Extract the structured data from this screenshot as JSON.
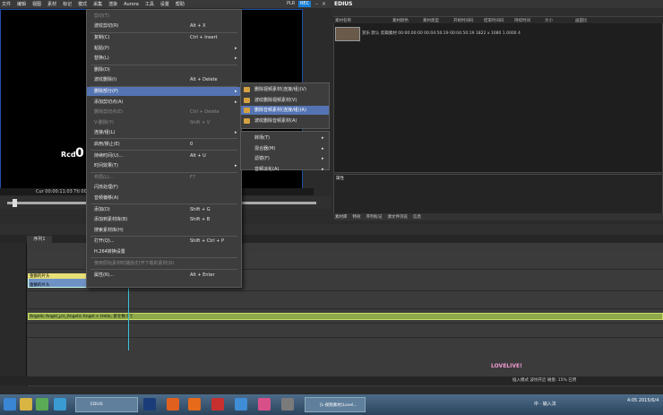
{
  "menubar": {
    "items": [
      "文件",
      "编辑",
      "视图",
      "素材",
      "标记",
      "模式",
      "采集",
      "渲染",
      "Aurora",
      "工具",
      "设置",
      "帮助"
    ]
  },
  "title": {
    "plr": "PLR",
    "rec": "REC",
    "app": "EDIUS"
  },
  "preview": {
    "rcd": "Rcd",
    "rcd_value": "0",
    "timecode": "Cur 00:00:11:03  Ttl 00:00:00:00"
  },
  "bin": {
    "header": [
      "素材名称",
      "素材颜色",
      "素材类型",
      "开始时间码",
      "结束时间码",
      "持续时间",
      "大小",
      "画面比"
    ],
    "clip_name": "赏乐",
    "clip_row": "赏乐   默认   剪辑素材   00:00:00:00  00:04:50:19  00:04:50:19  1822 x 1080  1.0000  4"
  },
  "bin_info": {
    "label": "属性"
  },
  "right_tabs": [
    "素材库",
    "特效",
    "序列标记",
    "源文件浏览",
    "信息"
  ],
  "timeline": {
    "tab": "序列1",
    "clip_v": "金额的片头",
    "clip_v2": "金额的片头",
    "audio": "Angelic Angel_µ's_Angelic Angel + Hello, 星を数えて",
    "status": "插入模式    波纹开启    磁盘: 15% 已用"
  },
  "logo": "LOVELIVE!",
  "taskbar": {
    "btn1": "EDIUS",
    "btn2": "[L-视频素材]Lovel...",
    "ime": "中 · 输入法",
    "clock": "4:05\n2015/6/4"
  },
  "context_menu": [
    {
      "label": "剪切(T)",
      "shortcut": "",
      "state": "disabled"
    },
    {
      "label": "波纹剪切(R)",
      "shortcut": "Alt + X",
      "state": "normal"
    },
    {
      "label": "复制(C)",
      "shortcut": "Ctrl + Insert",
      "state": "normal"
    },
    {
      "label": "粘贴(P)",
      "shortcut": "",
      "state": "submenu"
    },
    {
      "label": "替换(L)",
      "shortcut": "",
      "state": "submenu"
    },
    {
      "label": "删除(D)",
      "shortcut": "",
      "state": "normal"
    },
    {
      "label": "波纹删除(I)",
      "shortcut": "Alt + Delete",
      "state": "normal"
    },
    {
      "label": "删除部分(P)",
      "shortcut": "",
      "state": "highlighted"
    },
    {
      "label": "添加剪切点(A)",
      "shortcut": "",
      "state": "submenu"
    },
    {
      "label": "删除剪切点(E)",
      "shortcut": "Ctrl + Delete",
      "state": "disabled"
    },
    {
      "label": "V-删除(Y)",
      "shortcut": "Shift + V",
      "state": "disabled"
    },
    {
      "label": "连接/组(L)",
      "shortcut": "",
      "state": "submenu"
    },
    {
      "label": "启用/禁止(E)",
      "shortcut": "0",
      "state": "normal"
    },
    {
      "label": "持续时间(U)...",
      "shortcut": "Alt + U",
      "state": "normal"
    },
    {
      "label": "时间效果(T)",
      "shortcut": "",
      "state": "submenu"
    },
    {
      "label": "布局(L)...",
      "shortcut": "F7",
      "state": "disabled"
    },
    {
      "label": "闪烁处理(F)",
      "shortcut": "",
      "state": "normal"
    },
    {
      "label": "音频偏移(A)",
      "shortcut": "",
      "state": "normal"
    },
    {
      "label": "添加(D)",
      "shortcut": "Shift + G",
      "state": "normal"
    },
    {
      "label": "添加到素材库(B)",
      "shortcut": "Shift + B",
      "state": "normal"
    },
    {
      "label": "搜索素材库(H)",
      "shortcut": "",
      "state": "normal"
    },
    {
      "label": "打开(Q)...",
      "shortcut": "Shift + Ctrl + P",
      "state": "normal"
    },
    {
      "label": "H.264转换设置",
      "shortcut": "",
      "state": "normal"
    },
    {
      "label": "使用原始素材时播放/打开下载的素材(D)",
      "shortcut": "",
      "state": "disabled"
    },
    {
      "label": "属性(R)...",
      "shortcut": "Alt + Enter",
      "state": "normal"
    }
  ],
  "submenu1": [
    {
      "label": "删除视频素材(连接/组)(V)",
      "state": "normal"
    },
    {
      "label": "波纹删除视频素材(V)",
      "state": "normal"
    },
    {
      "label": "删除音频素材(连接/组)(A)",
      "state": "highlighted"
    },
    {
      "label": "波纹删除音频素材(A)",
      "state": "normal"
    }
  ],
  "submenu2": [
    {
      "label": "转场(T)",
      "state": "submenu"
    },
    {
      "label": "混合器(M)",
      "state": "submenu"
    },
    {
      "label": "滤镜(F)",
      "state": "submenu"
    },
    {
      "label": "音频淡化(A)",
      "state": "submenu"
    }
  ]
}
